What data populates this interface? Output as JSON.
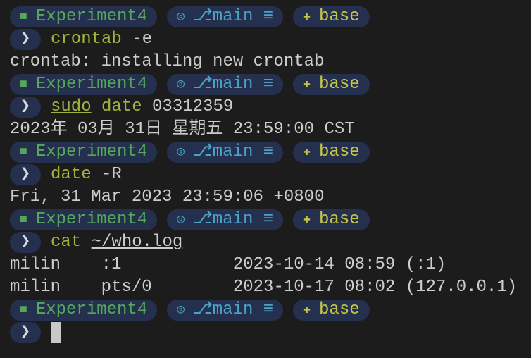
{
  "prompt": {
    "dir": "Experiment4",
    "branch": "main",
    "branch_status": "≡",
    "env": "base",
    "dir_icon": "folder-icon",
    "git_icon": "github-icon",
    "env_icon": "python-icon",
    "chevron": "❯"
  },
  "blocks": [
    {
      "cmd": "crontab",
      "cmd_underline": false,
      "args": " -e",
      "args_underline": false,
      "output": [
        "crontab: installing new crontab"
      ]
    },
    {
      "cmd": "sudo",
      "cmd_underline": true,
      "rest": " date",
      "args": " 03312359",
      "args_underline": false,
      "output": [
        "2023年 03月 31日 星期五 23:59:00 CST"
      ]
    },
    {
      "cmd": "date",
      "cmd_underline": false,
      "args": " -R",
      "args_underline": false,
      "output": [
        "Fri, 31 Mar 2023 23:59:06 +0800"
      ]
    },
    {
      "cmd": "cat",
      "cmd_underline": false,
      "args": "~/who.log",
      "args_underline": true,
      "output": [
        "milin    :1           2023-10-14 08:59 (:1)",
        "milin    pts/0        2023-10-17 08:02 (127.0.0.1)"
      ]
    }
  ]
}
